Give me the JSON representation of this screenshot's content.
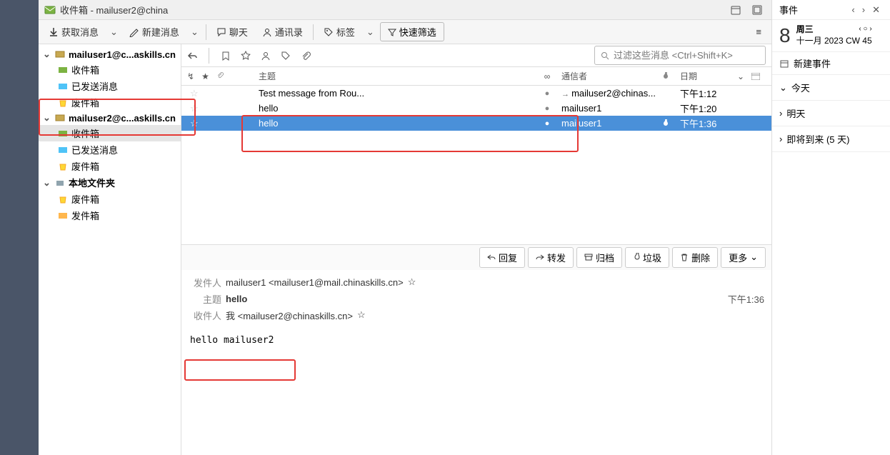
{
  "title": "收件箱 - mailuser2@china",
  "toolbar": {
    "get": "获取消息",
    "new": "新建消息",
    "chat": "聊天",
    "contacts": "通讯录",
    "tag": "标签",
    "filter": "快速筛选"
  },
  "accounts": [
    {
      "name": "mailuser1@c...askills.cn",
      "folders": [
        "收件箱",
        "已发送消息",
        "废件箱"
      ]
    },
    {
      "name": "mailuser2@c...askills.cn",
      "folders": [
        "收件箱",
        "已发送消息",
        "废件箱"
      ],
      "selectedFolder": 0
    }
  ],
  "localFolders": {
    "label": "本地文件夹",
    "folders": [
      "废件箱",
      "发件箱"
    ]
  },
  "search": {
    "placeholder": "过滤这些消息 <Ctrl+Shift+K>"
  },
  "columns": {
    "subject": "主题",
    "sender": "通信者",
    "date": "日期"
  },
  "messages": [
    {
      "subject": "Test message from Rou...",
      "sender": "mailuser2@chinas...",
      "date": "下午1:12",
      "replied": true
    },
    {
      "subject": "hello",
      "sender": "mailuser1",
      "date": "下午1:20"
    },
    {
      "subject": "hello",
      "sender": "mailuser1",
      "date": "下午1:36",
      "selected": true
    }
  ],
  "actions": {
    "reply": "回复",
    "forward": "转发",
    "archive": "归档",
    "junk": "垃圾",
    "delete": "删除",
    "more": "更多"
  },
  "preview": {
    "fromLabel": "发件人",
    "fromName": "mailuser1 <mailuser1@mail.chinaskills.cn>",
    "subjectLabel": "主题",
    "subject": "hello",
    "time": "下午1:36",
    "toLabel": "收件人",
    "toValue": "我 <mailuser2@chinaskills.cn>",
    "body": "hello mailuser2"
  },
  "events": {
    "title": "事件",
    "day": "8",
    "weekday": "周三",
    "month": "十一月",
    "year": "2023",
    "cw": "CW 45",
    "new": "新建事件",
    "sections": [
      "今天",
      "明天",
      "即将到来 (5 天)"
    ]
  }
}
